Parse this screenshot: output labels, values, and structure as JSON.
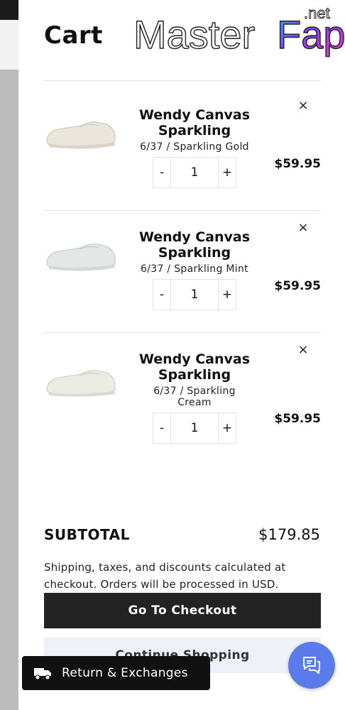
{
  "cart": {
    "title": "Cart",
    "items": [
      {
        "name": "Wendy Canvas Sparkling",
        "variant": "6/37 / Sparkling Gold",
        "quantity": "1",
        "price": "$59.95",
        "decrement": "-",
        "increment": "+",
        "remove": "×"
      },
      {
        "name": "Wendy Canvas Sparkling",
        "variant": "6/37 / Sparkling Mint",
        "quantity": "1",
        "price": "$59.95",
        "decrement": "-",
        "increment": "+",
        "remove": "×"
      },
      {
        "name": "Wendy Canvas Sparkling",
        "variant": "6/37 / Sparkling Cream",
        "quantity": "1",
        "price": "$59.95",
        "decrement": "-",
        "increment": "+",
        "remove": "×"
      }
    ],
    "subtotal_label": "SUBTOTAL",
    "subtotal_value": "$179.85",
    "note": "Shipping, taxes, and discounts calculated at checkout. Orders will be processed in USD.",
    "checkout_label": "Go To Checkout",
    "continue_label": "Continue Shopping"
  },
  "watermark": {
    "main": "MasterFap",
    "suffix": ".net"
  },
  "returns_widget": {
    "label": "Return & Exchanges",
    "icon": "truck-icon"
  },
  "chat_widget": {
    "icon": "chat-icon"
  },
  "colors": {
    "accent": "#5b7bea",
    "checkout_bg": "#232323",
    "continue_bg": "#eef1f8"
  }
}
